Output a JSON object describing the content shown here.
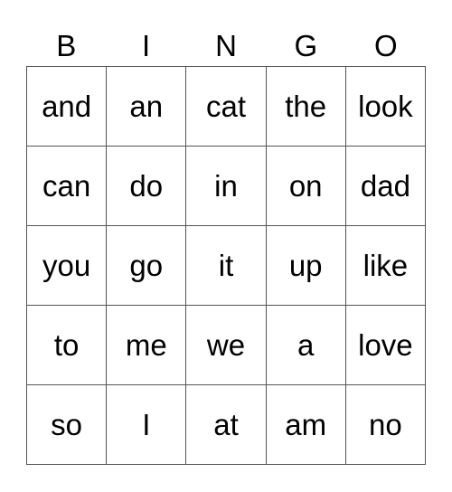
{
  "header": [
    "B",
    "I",
    "N",
    "G",
    "O"
  ],
  "rows": [
    [
      "and",
      "an",
      "cat",
      "the",
      "look"
    ],
    [
      "can",
      "do",
      "in",
      "on",
      "dad"
    ],
    [
      "you",
      "go",
      "it",
      "up",
      "like"
    ],
    [
      "to",
      "me",
      "we",
      "a",
      "love"
    ],
    [
      "so",
      "I",
      "at",
      "am",
      "no"
    ]
  ]
}
